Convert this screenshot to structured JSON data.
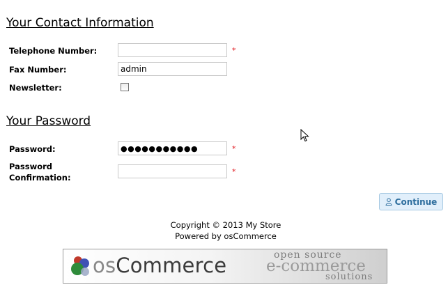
{
  "contact": {
    "title": "Your Contact Information",
    "telephone_label": "Telephone Number:",
    "telephone_value": "",
    "fax_label": "Fax Number:",
    "fax_value": "admin",
    "newsletter_label": "Newsletter:",
    "newsletter_checked": false,
    "required_marker": "*"
  },
  "password": {
    "title": "Your Password",
    "password_label": "Password:",
    "password_value": "●●●●●●●●●●●",
    "confirm_label_line1": "Password",
    "confirm_label_line2": "Confirmation:",
    "confirm_value": "",
    "required_marker": "*"
  },
  "actions": {
    "continue_label": "Continue"
  },
  "footer": {
    "copyright": "Copyright © 2013 My Store",
    "powered_by": "Powered by osCommerce"
  },
  "banner": {
    "logo_prefix": "os",
    "logo_main": "Commerce",
    "tagline_1": "open source",
    "tagline_2": "e-commerce",
    "tagline_3": "solutions"
  },
  "colors": {
    "required": "#e0191f",
    "button_bg": "#e1effb",
    "button_text": "#2e6e9e",
    "button_border": "#a6c9e2"
  }
}
